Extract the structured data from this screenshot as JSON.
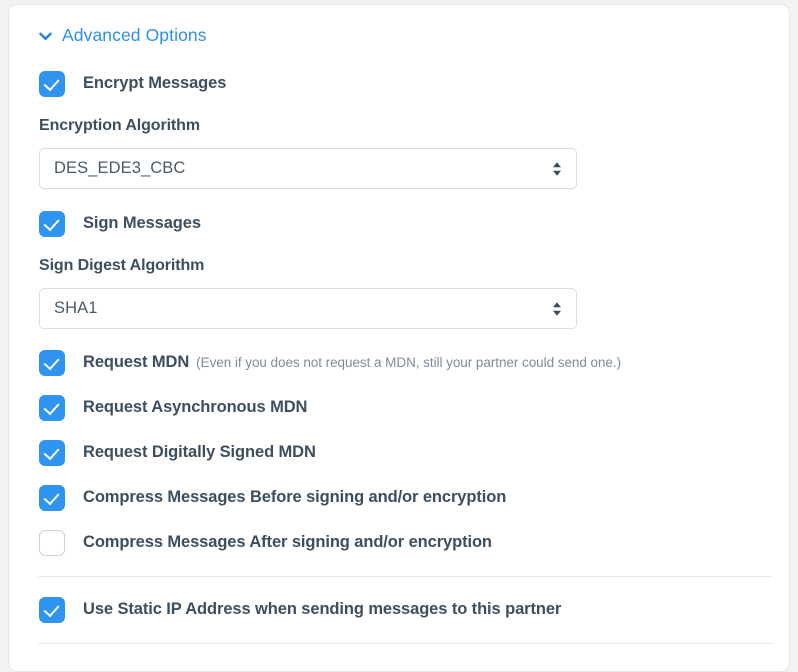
{
  "card": {
    "header": {
      "label": "Advanced Options",
      "icon": "chevron-down-icon",
      "color": "#2f8fee",
      "expanded": "true"
    }
  },
  "colors": {
    "accent": "#2f8fee",
    "checkbox_on": "#2f93f0",
    "checkbox_off_border": "#c5d3dd",
    "label_text": "#3d4f5e",
    "hint_text": "#7e8c99",
    "select_text": "#4a5a68",
    "border": "#d9dde2",
    "divider": "#e6e8ea",
    "page_background": "#f2f3f5",
    "card_background": "#ffffff"
  },
  "options": {
    "encrypt_messages": {
      "label": "Encrypt Messages",
      "checked": "true"
    },
    "encryption_algorithm": {
      "label": "Encryption Algorithm",
      "value": "DES_EDE3_CBC",
      "options": [
        "DES_EDE3_CBC"
      ]
    },
    "sign_messages": {
      "label": "Sign Messages",
      "checked": "true"
    },
    "sign_digest_algorithm": {
      "label": "Sign Digest Algorithm",
      "value": "SHA1",
      "options": [
        "SHA1"
      ]
    },
    "request_mdn": {
      "label": "Request MDN",
      "hint": "(Even if you does not request a MDN, still your partner could send one.)",
      "checked": "true"
    },
    "request_async_mdn": {
      "label": "Request Asynchronous MDN",
      "checked": "true"
    },
    "request_signed_mdn": {
      "label": "Request Digitally Signed MDN",
      "checked": "true"
    },
    "compress_before": {
      "label": "Compress Messages Before signing and/or encryption",
      "checked": "true"
    },
    "compress_after": {
      "label": "Compress Messages After signing and/or encryption",
      "checked": "false"
    },
    "static_ip": {
      "label": "Use Static IP Address when sending messages to this partner",
      "checked": "true"
    }
  }
}
